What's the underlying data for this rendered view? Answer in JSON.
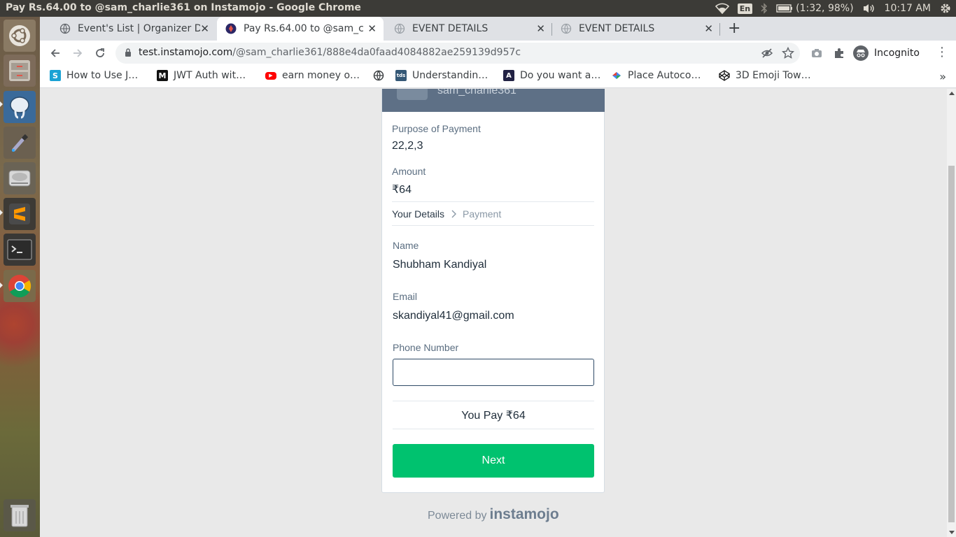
{
  "system": {
    "window_title": "Pay Rs.64.00 to @sam_charlie361 on Instamojo - Google Chrome",
    "keyboard_layout": "En",
    "battery": "(1:32, 98%)",
    "clock": "10:17 AM"
  },
  "launcher": {
    "items": [
      {
        "name": "ubuntu-dash"
      },
      {
        "name": "files"
      },
      {
        "name": "pgadmin"
      },
      {
        "name": "color-picker"
      },
      {
        "name": "disks"
      },
      {
        "name": "sublime-text"
      },
      {
        "name": "terminal"
      },
      {
        "name": "chrome"
      },
      {
        "name": "trash"
      }
    ]
  },
  "tabs": [
    {
      "label": "Event's List | Organizer Da",
      "active": false
    },
    {
      "label": "Pay Rs.64.00 to @sam_cha",
      "active": true
    },
    {
      "label": "EVENT DETAILS",
      "active": false
    },
    {
      "label": "EVENT DETAILS",
      "active": false
    }
  ],
  "address_bar": {
    "host": "test.instamojo.com",
    "path": "/@sam_charlie361/888e4da0faad4084882ae259139d957c"
  },
  "profile": {
    "label": "Incognito"
  },
  "bookmarks": [
    {
      "label": "How to Use J…",
      "icon": "S",
      "color": "#1aa2d4"
    },
    {
      "label": "JWT Auth wit…",
      "icon": "M",
      "color": "#111111"
    },
    {
      "label": "earn money o…",
      "icon": "yt",
      "color": "#ff0000"
    },
    {
      "label": "",
      "icon": "globe",
      "color": "#5f6368"
    },
    {
      "label": "Understandin…",
      "icon": "tds",
      "color": "#355876"
    },
    {
      "label": "Do you want a…",
      "icon": "A",
      "color": "#222244"
    },
    {
      "label": "Place Autoco…",
      "icon": "gm",
      "color": "#4285f4"
    },
    {
      "label": "3D Emoji Tow…",
      "icon": "cp",
      "color": "#111111"
    }
  ],
  "payment": {
    "username": "sam_charlie361",
    "purpose_label": "Purpose of Payment",
    "purpose_value": "22,2,3",
    "amount_label": "Amount",
    "amount_value": "₹64",
    "step_1": "Your Details",
    "step_2": "Payment",
    "name_label": "Name",
    "name_value": "Shubham Kandiyal",
    "email_label": "Email",
    "email_value": "skandiyal41@gmail.com",
    "phone_label": "Phone Number",
    "phone_value": "",
    "you_pay": "You Pay ₹64",
    "next_label": "Next",
    "powered_by": "Powered by",
    "brand": "instamojo"
  },
  "colors": {
    "accent_green": "#00c26f",
    "header_slate": "#5e7086",
    "input_border": "#2e4a66"
  }
}
